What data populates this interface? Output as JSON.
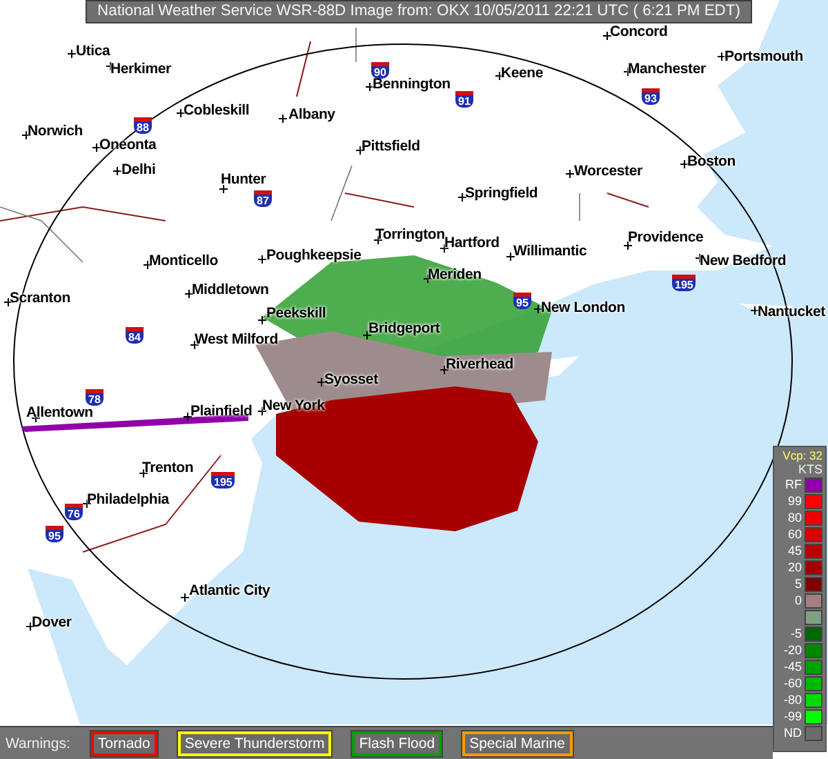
{
  "header": {
    "title": "National Weather Service WSR-88D Image from: OKX 10/05/2011 22:21 UTC ( 6:21 PM EDT)"
  },
  "map": {
    "places": [
      {
        "name": "Concord"
      },
      {
        "name": "Utica"
      },
      {
        "name": "Portsmouth"
      },
      {
        "name": "Herkimer"
      },
      {
        "name": "Keene"
      },
      {
        "name": "Manchester"
      },
      {
        "name": "Bennington"
      },
      {
        "name": "Cobleskill"
      },
      {
        "name": "Albany"
      },
      {
        "name": "Norwich"
      },
      {
        "name": "Oneonta"
      },
      {
        "name": "Pittsfield"
      },
      {
        "name": "Delhi"
      },
      {
        "name": "Worcester"
      },
      {
        "name": "Boston"
      },
      {
        "name": "Hunter"
      },
      {
        "name": "Springfield"
      },
      {
        "name": "Torrington"
      },
      {
        "name": "Hartford"
      },
      {
        "name": "Willimantic"
      },
      {
        "name": "Providence"
      },
      {
        "name": "Monticello"
      },
      {
        "name": "Poughkeepsie"
      },
      {
        "name": "New Bedford"
      },
      {
        "name": "Meriden"
      },
      {
        "name": "Scranton"
      },
      {
        "name": "Middletown"
      },
      {
        "name": "Peekskill"
      },
      {
        "name": "New London"
      },
      {
        "name": "Nantucket"
      },
      {
        "name": "Bridgeport"
      },
      {
        "name": "West Milford"
      },
      {
        "name": "Riverhead"
      },
      {
        "name": "Syosset"
      },
      {
        "name": "Allentown"
      },
      {
        "name": "Plainfield"
      },
      {
        "name": "New York"
      },
      {
        "name": "Trenton"
      },
      {
        "name": "Philadelphia"
      },
      {
        "name": "Atlantic City"
      },
      {
        "name": "Dover"
      }
    ],
    "route_shields": [
      {
        "number": "90"
      },
      {
        "number": "88"
      },
      {
        "number": "87"
      },
      {
        "number": "91"
      },
      {
        "number": "93"
      },
      {
        "number": "84"
      },
      {
        "number": "95"
      },
      {
        "number": "195"
      },
      {
        "number": "78"
      },
      {
        "number": "195"
      },
      {
        "number": "76"
      },
      {
        "number": "95"
      }
    ]
  },
  "legend": {
    "vcp": "Vcp: 32",
    "units": "KTS",
    "entries": [
      {
        "label": "RF",
        "color": "#9000a8"
      },
      {
        "label": "99",
        "color": "#ff0000"
      },
      {
        "label": "80",
        "color": "#ee0000"
      },
      {
        "label": "60",
        "color": "#d80000"
      },
      {
        "label": "45",
        "color": "#b80000"
      },
      {
        "label": "20",
        "color": "#a00000"
      },
      {
        "label": "5",
        "color": "#800000"
      },
      {
        "label": "0",
        "color": "#a08080"
      },
      {
        "color": "#80a080"
      },
      {
        "label": "-5",
        "color": "#006800"
      },
      {
        "label": "-20",
        "color": "#008800"
      },
      {
        "label": "-45",
        "color": "#00a000"
      },
      {
        "label": "-60",
        "color": "#00b800"
      },
      {
        "label": "-80",
        "color": "#00dc00"
      },
      {
        "label": "-99",
        "color": "#00ff00"
      },
      {
        "label": "ND",
        "color": "#6c6c6c"
      }
    ]
  },
  "warnings": {
    "label": "Warnings:",
    "types": [
      {
        "label": "Tornado",
        "color": "#ff0000"
      },
      {
        "label": "Severe Thunderstorm",
        "color": "#ffff00"
      },
      {
        "label": "Flash Flood",
        "color": "#00a000"
      },
      {
        "label": "Special Marine",
        "color": "#ff9900"
      }
    ]
  }
}
